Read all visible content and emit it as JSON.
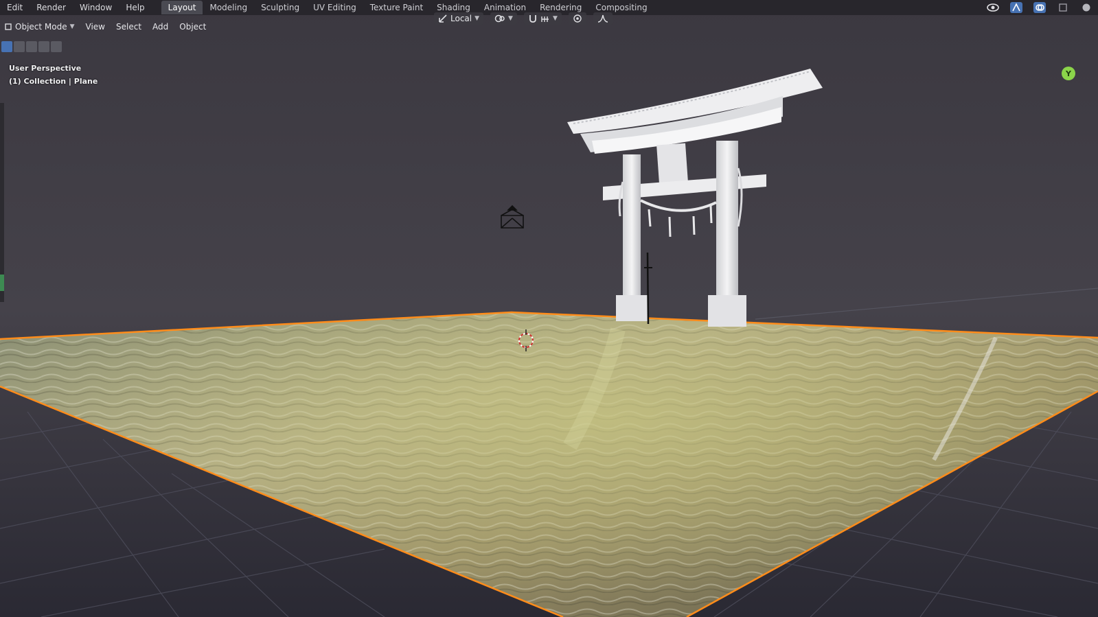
{
  "menus": [
    "Edit",
    "Render",
    "Window",
    "Help"
  ],
  "workspace_tabs": [
    {
      "label": "Layout",
      "active": true
    },
    {
      "label": "Modeling",
      "active": false
    },
    {
      "label": "Sculpting",
      "active": false
    },
    {
      "label": "UV Editing",
      "active": false
    },
    {
      "label": "Texture Paint",
      "active": false
    },
    {
      "label": "Shading",
      "active": false
    },
    {
      "label": "Animation",
      "active": false
    },
    {
      "label": "Rendering",
      "active": false
    },
    {
      "label": "Compositing",
      "active": false
    }
  ],
  "header": {
    "mode": "Object Mode",
    "view_menu": "View",
    "select_menu": "Select",
    "add_menu": "Add",
    "object_menu": "Object"
  },
  "tools": {
    "transform_orientation": "Local"
  },
  "viewport": {
    "view_name": "User Perspective",
    "collection_info": "(1) Collection | Plane",
    "gizmo_axis": "Y"
  },
  "colors": {
    "accent_selected": "#ff8c1a",
    "active_tab": "#4a4a52",
    "select_mode_active": "#4772b3",
    "gizmo_y": "#8bd44a"
  },
  "icons": {
    "orientation": "transform-orientation-icon",
    "pivot": "pivot-point-icon",
    "snap": "snap-magnet-icon",
    "proportional": "proportional-edit-icon",
    "falloff": "falloff-curve-icon",
    "visibility": "visibility-eye-icon",
    "gizmo": "gizmo-toggle-icon",
    "overlay": "overlay-icon",
    "xray": "xray-toggle-icon",
    "shading": "viewport-shading-icon"
  }
}
